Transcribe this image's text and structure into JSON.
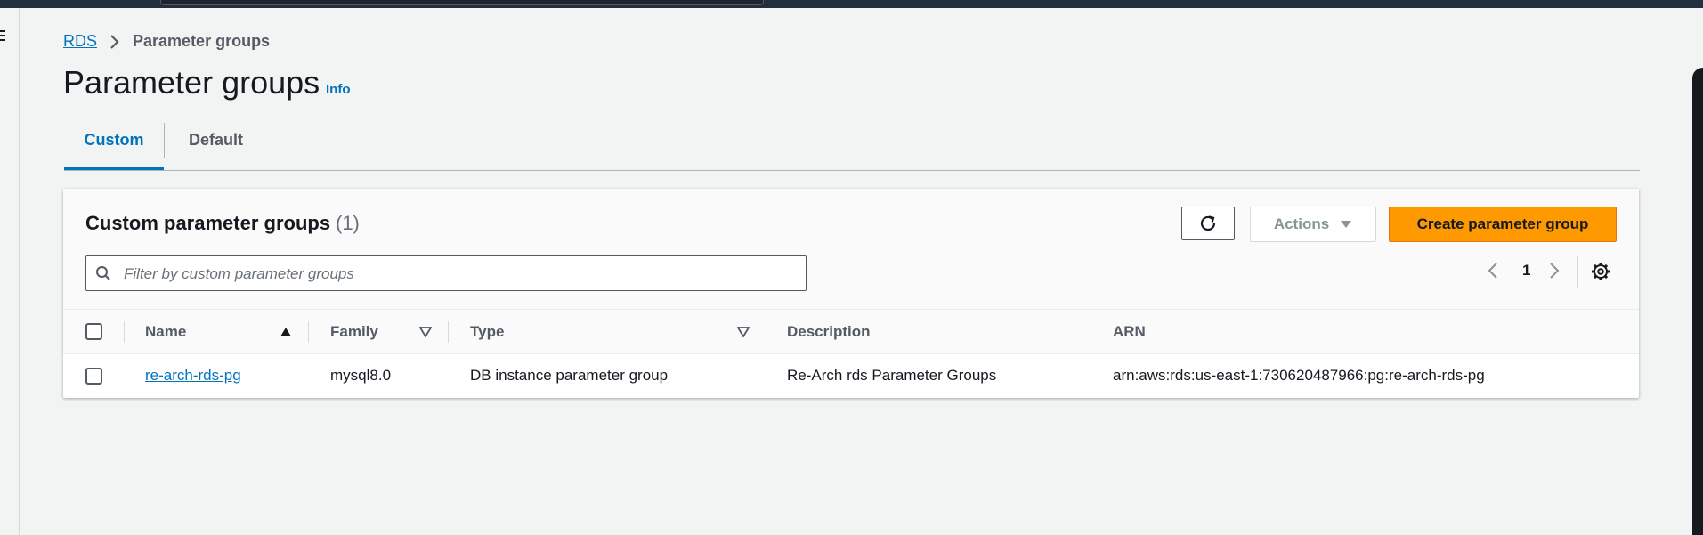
{
  "breadcrumb": {
    "root": "RDS",
    "current": "Parameter groups"
  },
  "page": {
    "title": "Parameter groups",
    "info": "Info"
  },
  "tabs": [
    {
      "label": "Custom",
      "active": true
    },
    {
      "label": "Default",
      "active": false
    }
  ],
  "panel": {
    "title": "Custom parameter groups",
    "count": "(1)",
    "actions_label": "Actions",
    "create_label": "Create parameter group",
    "search_placeholder": "Filter by custom parameter groups",
    "search_value": "",
    "page_number": "1"
  },
  "table": {
    "columns": [
      "Name",
      "Family",
      "Type",
      "Description",
      "ARN"
    ],
    "sort": {
      "column": "Name",
      "direction": "ascending"
    },
    "rows": [
      {
        "name": "re-arch-rds-pg",
        "family": "mysql8.0",
        "type": "DB instance parameter group",
        "description": "Re-Arch rds Parameter Groups",
        "arn": "arn:aws:rds:us-east-1:730620487966:pg:re-arch-rds-pg"
      }
    ]
  },
  "colors": {
    "accent": "#0073bb",
    "primary_button": "#ff9900",
    "topbar": "#232f3e"
  }
}
